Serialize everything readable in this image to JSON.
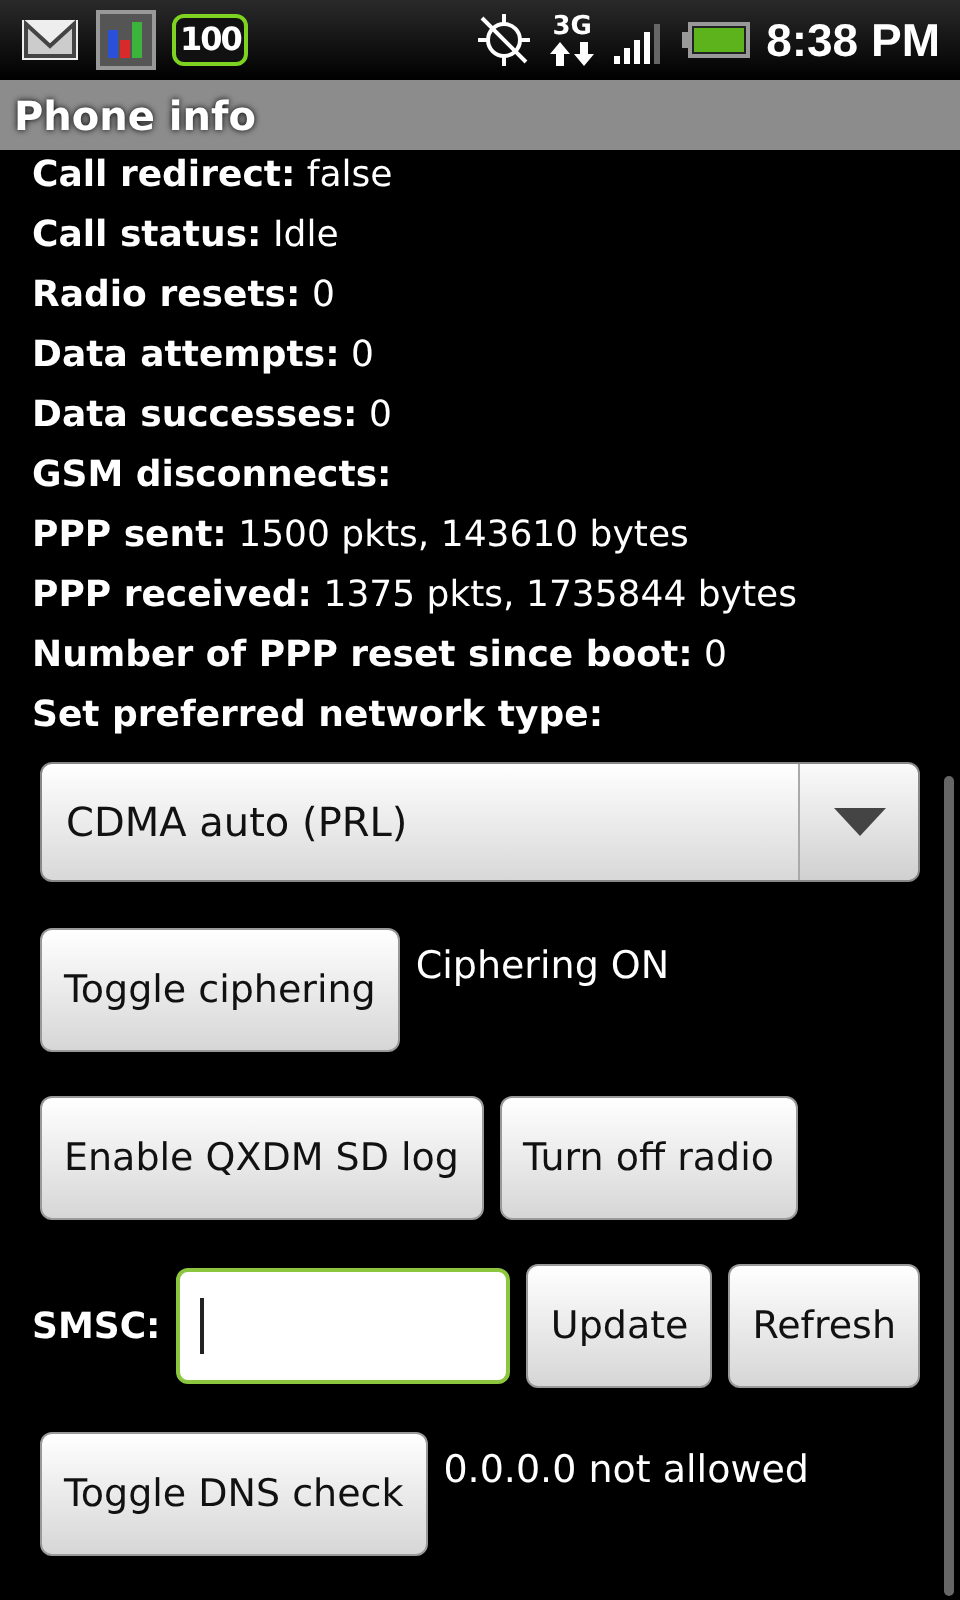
{
  "status_bar": {
    "badge": "100",
    "network": "3G",
    "time": "8:38 PM"
  },
  "title": "Phone info",
  "info_rows": [
    {
      "label": "Call redirect:",
      "value": "false"
    },
    {
      "label": "Call status:",
      "value": "Idle"
    },
    {
      "label": "Radio resets:",
      "value": "0"
    },
    {
      "label": "Data attempts:",
      "value": "0"
    },
    {
      "label": "Data successes:",
      "value": "0"
    },
    {
      "label": "GSM disconnects:"
    },
    {
      "label": "PPP sent:",
      "value": "1500 pkts, 143610 bytes"
    },
    {
      "label": "PPP received:",
      "value": "1375 pkts, 1735844 bytes"
    },
    {
      "label": "Number of PPP reset since boot:",
      "value": "0"
    },
    {
      "label": "Set preferred network type:"
    }
  ],
  "network_type": {
    "value": "CDMA auto (PRL)"
  },
  "ciphering": {
    "button": "Toggle ciphering",
    "status": "Ciphering ON"
  },
  "log_buttons": [
    "Enable QXDM SD log",
    "Turn off radio"
  ],
  "smsc": {
    "label": "SMSC:",
    "buttons": [
      "Update",
      "Refresh"
    ]
  },
  "dns": {
    "button": "Toggle DNS check",
    "status": "0.0.0.0 not allowed"
  }
}
